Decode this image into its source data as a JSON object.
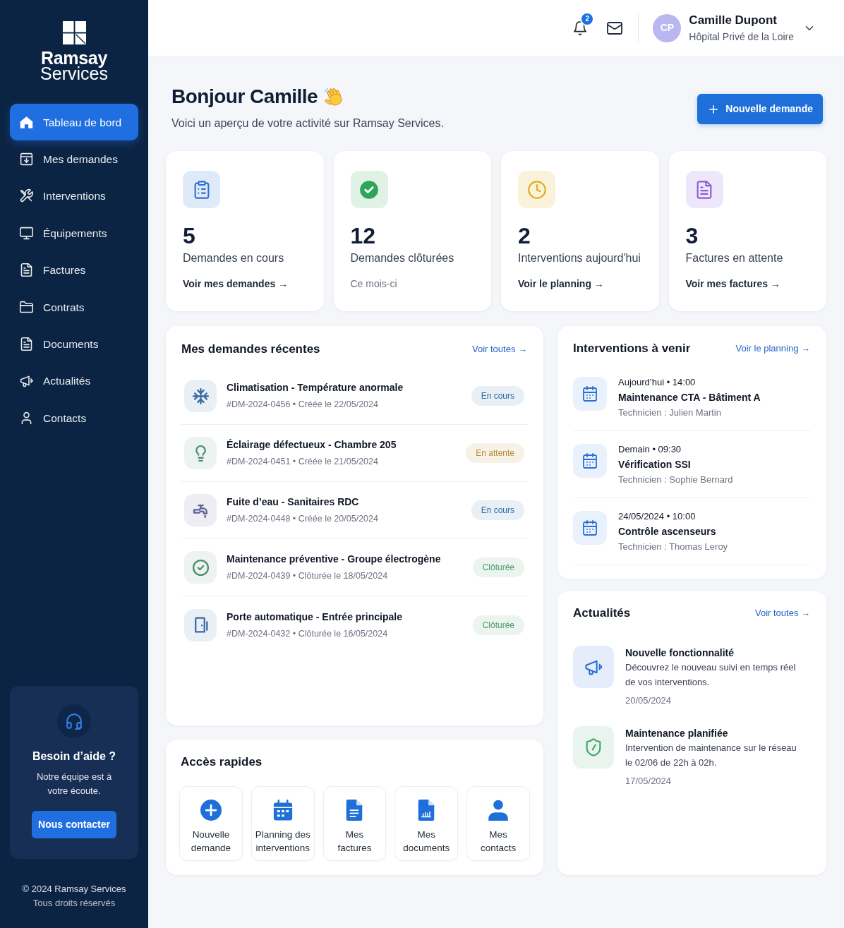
{
  "sidebar": {
    "logo": {
      "title": "Ramsay",
      "subtitle": "Services"
    },
    "items": [
      {
        "label": "Tableau de bord",
        "selected": true
      },
      {
        "label": "Mes demandes",
        "selected": false
      },
      {
        "label": "Interventions",
        "selected": false
      },
      {
        "label": "Équipements",
        "selected": false
      },
      {
        "label": "Factures",
        "selected": false
      },
      {
        "label": "Contrats",
        "selected": false
      },
      {
        "label": "Documents",
        "selected": false
      },
      {
        "label": "Actualités",
        "selected": false
      },
      {
        "label": "Contacts",
        "selected": false
      }
    ],
    "help": {
      "title": "Besoin d’aide ?",
      "text": "Notre équipe est à votre écoute.",
      "button": "Nous contacter"
    },
    "footer": {
      "copyright": "© 2024 Ramsay Services",
      "rights": "Tous droits réservés"
    }
  },
  "header": {
    "notification_count": "2",
    "user": {
      "initials": "CP",
      "name": "Camille Dupont",
      "organization": "Hôpital Privé de la Loire"
    }
  },
  "greeting": {
    "title": "Bonjour Camille",
    "subtitle": "Voici un aperçu de votre activité sur Ramsay Services.",
    "button": "Nouvelle demande"
  },
  "stats": [
    {
      "value": "5",
      "label": "Demandes en cours",
      "link": "Voir mes demandes →",
      "color": "#2b6fd6"
    },
    {
      "value": "12",
      "label": "Demandes clôturées",
      "note": "Ce mois-ci",
      "color": "#2ea55a"
    },
    {
      "value": "2",
      "label": "Interventions aujourd'hui",
      "link": "Voir le planning →",
      "color": "#e6a817"
    },
    {
      "value": "3",
      "label": "Factures en attente",
      "link": "Voir mes factures →",
      "color": "#8a5cd8"
    }
  ],
  "recent_requests": {
    "title": "Mes demandes récentes",
    "link": "Voir toutes →",
    "rows": [
      {
        "title": "Climatisation - Température anormale",
        "meta": "#DM-2024-0456 • Créée le 22/05/2024",
        "color": "#3a6aa6",
        "status": {
          "label": "En cours",
          "color": "#2f6aa8"
        }
      },
      {
        "title": "Éclairage défectueux - Chambre 205",
        "meta": "#DM-2024-0451 • Créée le 21/05/2024",
        "color": "#4f8f72",
        "status": {
          "label": "En attente",
          "color": "#b98a2a"
        }
      },
      {
        "title": "Fuite d’eau - Sanitaires RDC",
        "meta": "#DM-2024-0448 • Créée le 20/05/2024",
        "color": "#5f5f96",
        "status": {
          "label": "En cours",
          "color": "#2f6aa8"
        }
      },
      {
        "title": "Maintenance préventive - Groupe électrogène",
        "meta": "#DM-2024-0439 • Clôturée le 18/05/2024",
        "color": "#4f8f72",
        "status": {
          "label": "Clôturée",
          "color": "#4a9a6a"
        }
      },
      {
        "title": "Porte automatique - Entrée principale",
        "meta": "#DM-2024-0432 • Clôturée le 16/05/2024",
        "color": "#3a6aa6",
        "status": {
          "label": "Clôturée",
          "color": "#4a9a6a"
        }
      }
    ]
  },
  "quick_access": {
    "title": "Accès rapides",
    "items": [
      "Nouvelle\ndemande",
      "Planning des\ninterventions",
      "Mes\nfactures",
      "Mes\ndocuments",
      "Mes\ncontacts"
    ]
  },
  "upcoming_interventions": {
    "title": "Interventions à venir",
    "link": "Voir le planning →",
    "items": [
      {
        "when": "Aujourd’hui • 14:00",
        "title": "Maintenance CTA - Bâtiment A",
        "technician": "Technicien : Julien Martin"
      },
      {
        "when": "Demain • 09:30",
        "title": "Vérification SSI",
        "technician": "Technicien : Sophie Bernard"
      },
      {
        "when": "24/05/2024 • 10:00",
        "title": "Contrôle ascenseurs",
        "technician": "Technicien : Thomas Leroy"
      }
    ]
  },
  "news": {
    "title": "Actualités",
    "link": "Voir toutes →",
    "items": [
      {
        "title": "Nouvelle fonctionnalité",
        "text": "Découvrez le nouveau suivi en temps réel de vos interventions.",
        "date": "20/05/2024",
        "color": "#2b6fd6"
      },
      {
        "title": "Maintenance planifiée",
        "text": "Intervention de maintenance sur le réseau le 02/06 de 22h à 02h.",
        "date": "17/05/2024",
        "color": "#3fa76a"
      }
    ]
  }
}
